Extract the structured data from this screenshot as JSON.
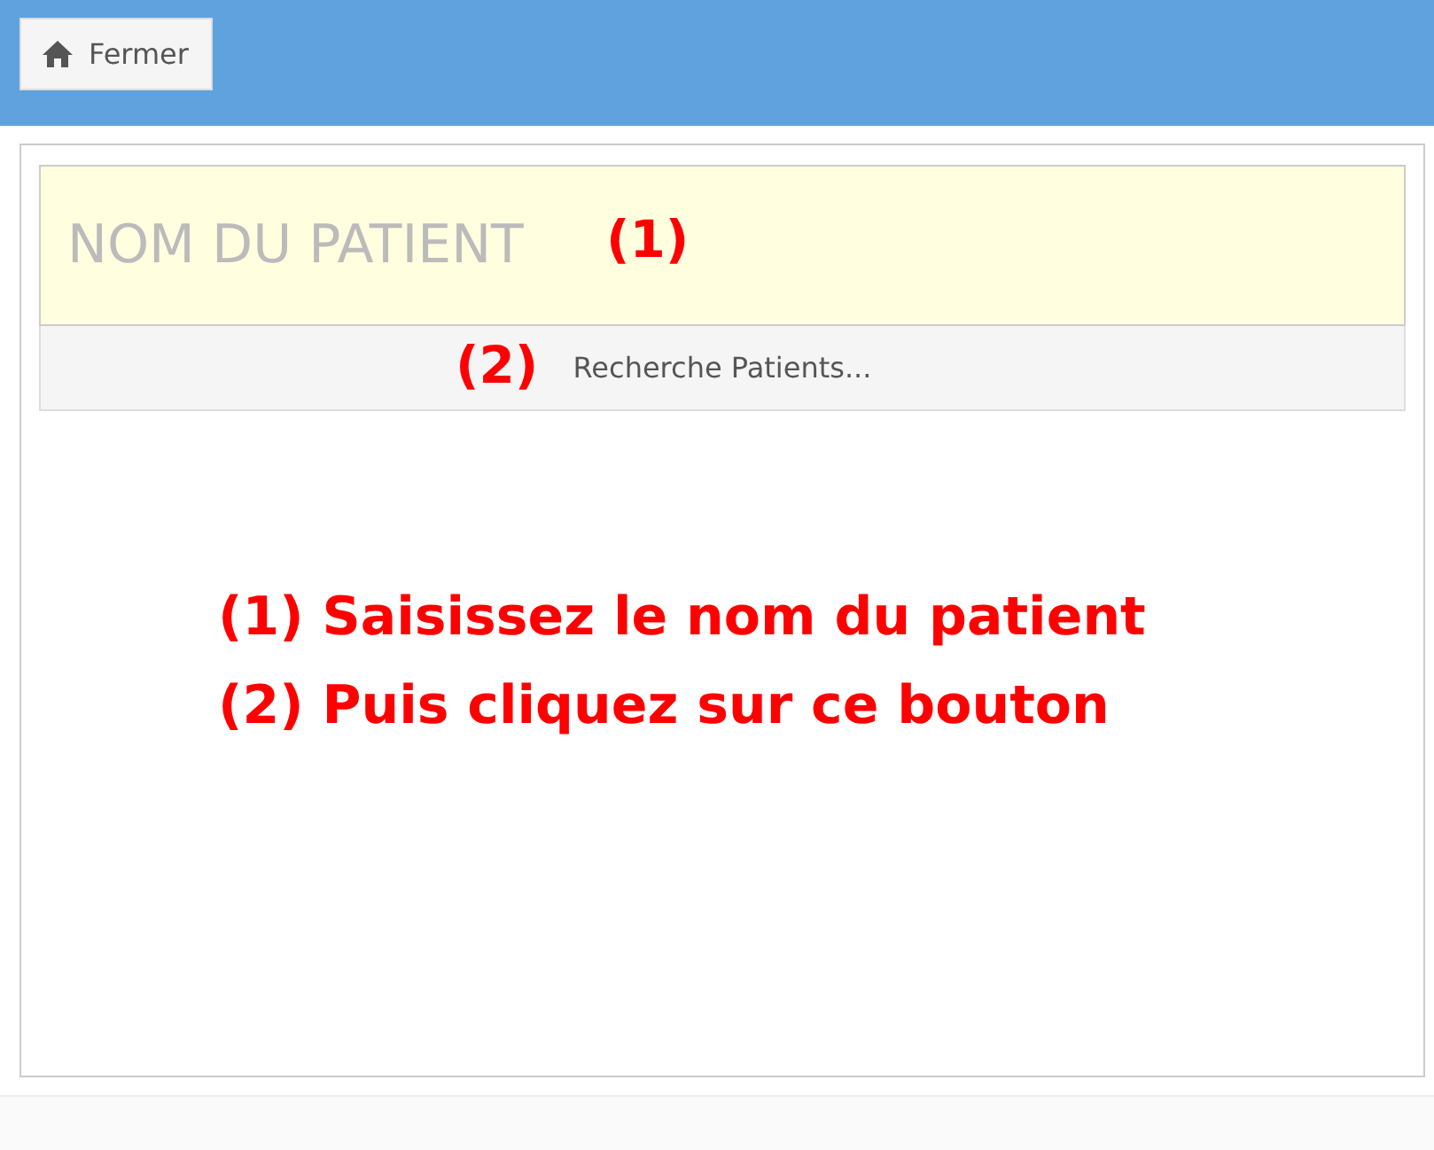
{
  "toolbar": {
    "close_button": {
      "label": "Fermer"
    }
  },
  "search_form": {
    "patient_name_field": {
      "placeholder": "NOM DU PATIENT",
      "annotation": "(1)"
    },
    "search_button": {
      "label": "Recherche Patients...",
      "annotation": "(2)"
    }
  },
  "instructions": [
    "(1) Saisissez le nom du patient",
    "(2) Puis cliquez sur ce bouton"
  ]
}
